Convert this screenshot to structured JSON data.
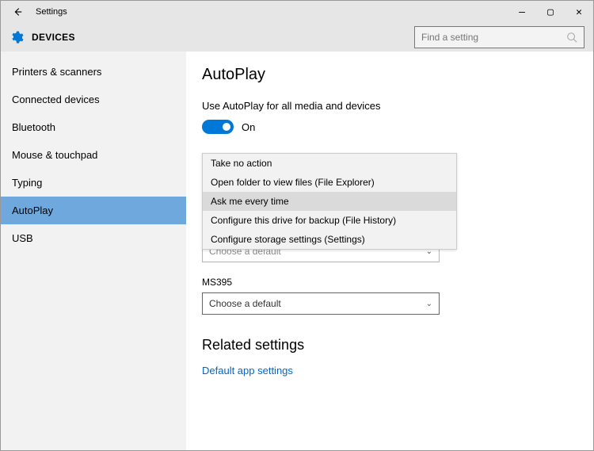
{
  "window": {
    "title": "Settings"
  },
  "header": {
    "title": "DEVICES"
  },
  "search": {
    "placeholder": "Find a setting"
  },
  "sidebar": {
    "items": [
      {
        "label": "Printers & scanners"
      },
      {
        "label": "Connected devices"
      },
      {
        "label": "Bluetooth"
      },
      {
        "label": "Mouse & touchpad"
      },
      {
        "label": "Typing"
      },
      {
        "label": "AutoPlay"
      },
      {
        "label": "USB"
      }
    ]
  },
  "page": {
    "title": "AutoPlay",
    "toggle_label": "Use AutoPlay for all media and devices",
    "toggle_state": "On",
    "dropdown_options": [
      "Take no action",
      "Open folder to view files (File Explorer)",
      "Ask me every time",
      "Configure this drive for backup (File History)",
      "Configure storage settings (Settings)"
    ],
    "behind_select_value": "Choose a default",
    "device_label": "MS395",
    "device_select_value": "Choose a default",
    "related_title": "Related settings",
    "related_link": "Default app settings"
  }
}
